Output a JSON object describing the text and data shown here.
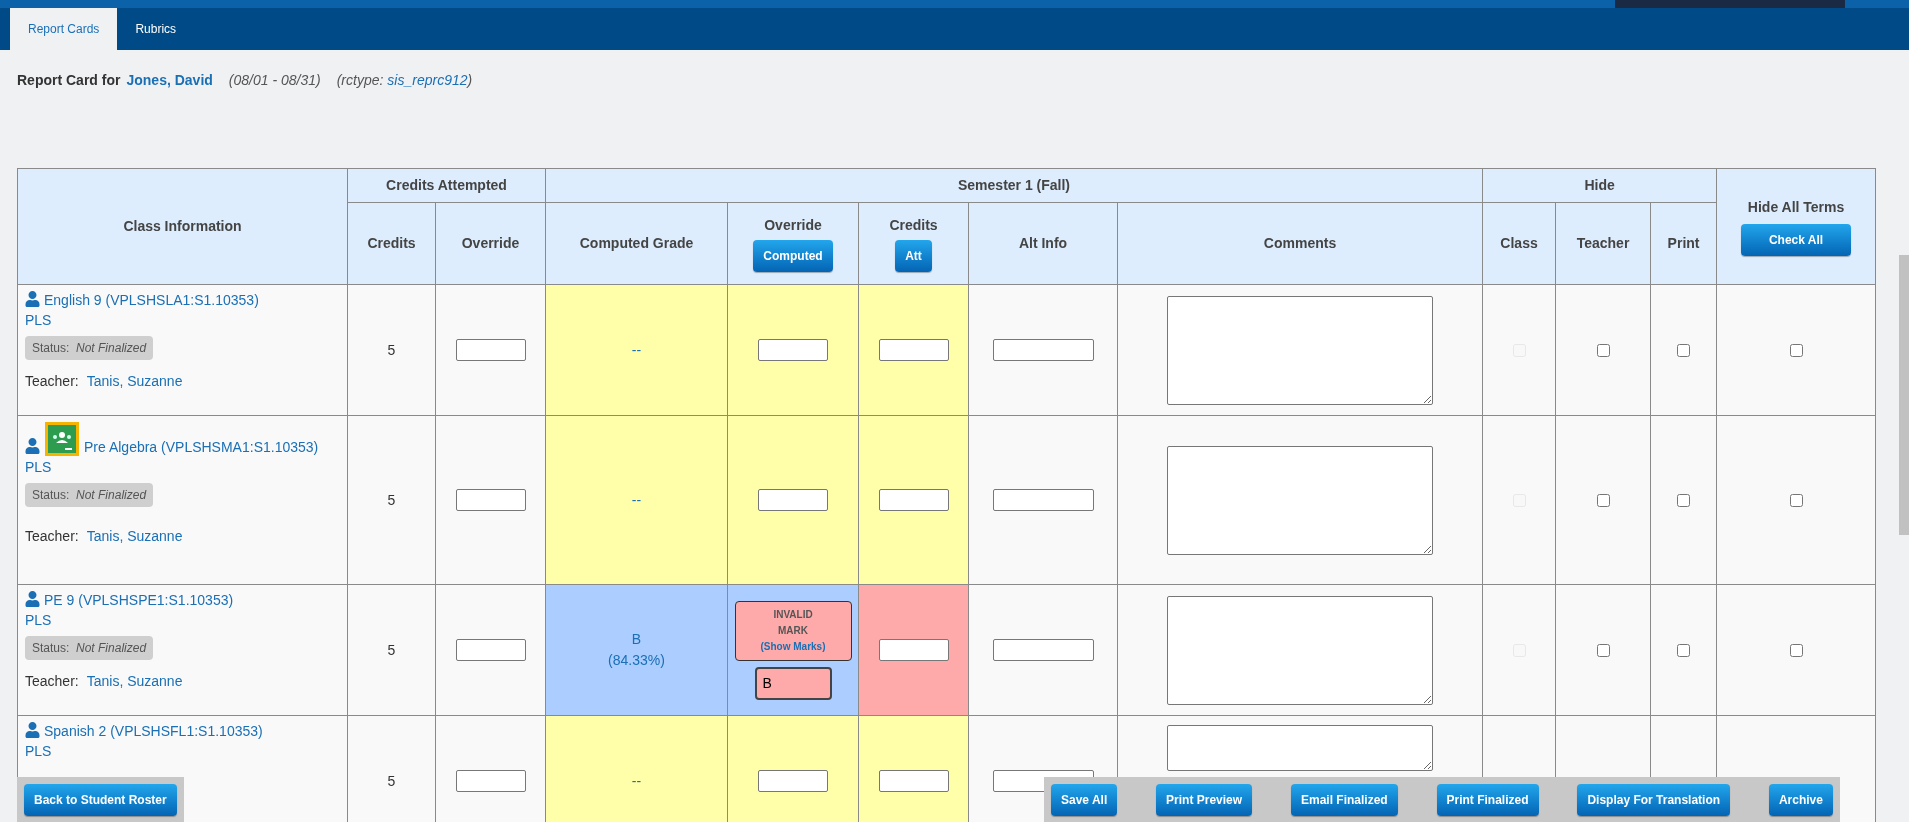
{
  "tabs": [
    {
      "label": "Report Cards",
      "selected": true
    },
    {
      "label": "Rubrics",
      "selected": false
    }
  ],
  "heading": {
    "prefix": "Report Card for",
    "student": "Jones, David",
    "dates": "(08/01 - 08/31)",
    "rctype_label": "(rctype:",
    "rctype_value": "sis_reprc912",
    "rctype_close": ")"
  },
  "table": {
    "group_headers": {
      "class_information": "Class Information",
      "credits_attempted": "Credits Attempted",
      "semester": "Semester 1 (Fall)",
      "hide": "Hide",
      "hide_all_terms": "Hide All Terms"
    },
    "columns": {
      "credits": "Credits",
      "override": "Override",
      "computed_grade": "Computed Grade",
      "grade_override": "Override",
      "grade_override_button": "Computed",
      "credits_att": "Credits",
      "credits_att_button": "Att",
      "alt_info": "Alt Info",
      "comments": "Comments",
      "class": "Class",
      "teacher": "Teacher",
      "print": "Print"
    },
    "check_all_button": "Check All",
    "rows": [
      {
        "class_name": "English 9 (VPLSHSLA1:S1.10353)",
        "classroom": false,
        "section": "PLS",
        "status_label": "Status:",
        "status": "Not Finalized",
        "teacher_label": "Teacher:",
        "teacher": "Tanis, Suzanne",
        "credits": "5",
        "kind": "pending",
        "grade": "--",
        "hide_class": {
          "checked": false,
          "disabled": true
        },
        "hide_teacher": {
          "checked": false
        },
        "hide_print": {
          "checked": false
        },
        "hide_all": {
          "checked": false
        }
      },
      {
        "class_name": "Pre Algebra (VPLSHSMA1:S1.10353)",
        "classroom": true,
        "section": "PLS",
        "status_label": "Status:",
        "status": "Not Finalized",
        "teacher_label": "Teacher:",
        "teacher": "Tanis, Suzanne",
        "credits": "5",
        "kind": "pending",
        "grade": "--",
        "hide_class": {
          "checked": false,
          "disabled": true
        },
        "hide_teacher": {
          "checked": false
        },
        "hide_print": {
          "checked": false
        },
        "hide_all": {
          "checked": false
        }
      },
      {
        "class_name": "PE 9 (VPLSHSPE1:S1.10353)",
        "classroom": false,
        "section": "PLS",
        "status_label": "Status:",
        "status": "Not Finalized",
        "teacher_label": "Teacher:",
        "teacher": "Tanis, Suzanne",
        "credits": "5",
        "kind": "invalid",
        "grade": "B",
        "grade_percent": "(84.33%)",
        "error": "INVALID MARK",
        "error_link": "(Show Marks)",
        "override_value": "B",
        "hide_class": {
          "checked": false,
          "disabled": true
        },
        "hide_teacher": {
          "checked": false
        },
        "hide_print": {
          "checked": false
        },
        "hide_all": {
          "checked": false
        }
      },
      {
        "class_name": "Spanish 2 (VPLSHSFL1:S1.10353)",
        "classroom": false,
        "section": "PLS",
        "credits": "5",
        "kind": "pending",
        "grade": "--"
      }
    ]
  },
  "footer_left": [
    "Back to Student Roster"
  ],
  "footer_right": [
    "Save All",
    "Print Preview",
    "Email Finalized",
    "Print Finalized",
    "Display For Translation",
    "Archive"
  ]
}
